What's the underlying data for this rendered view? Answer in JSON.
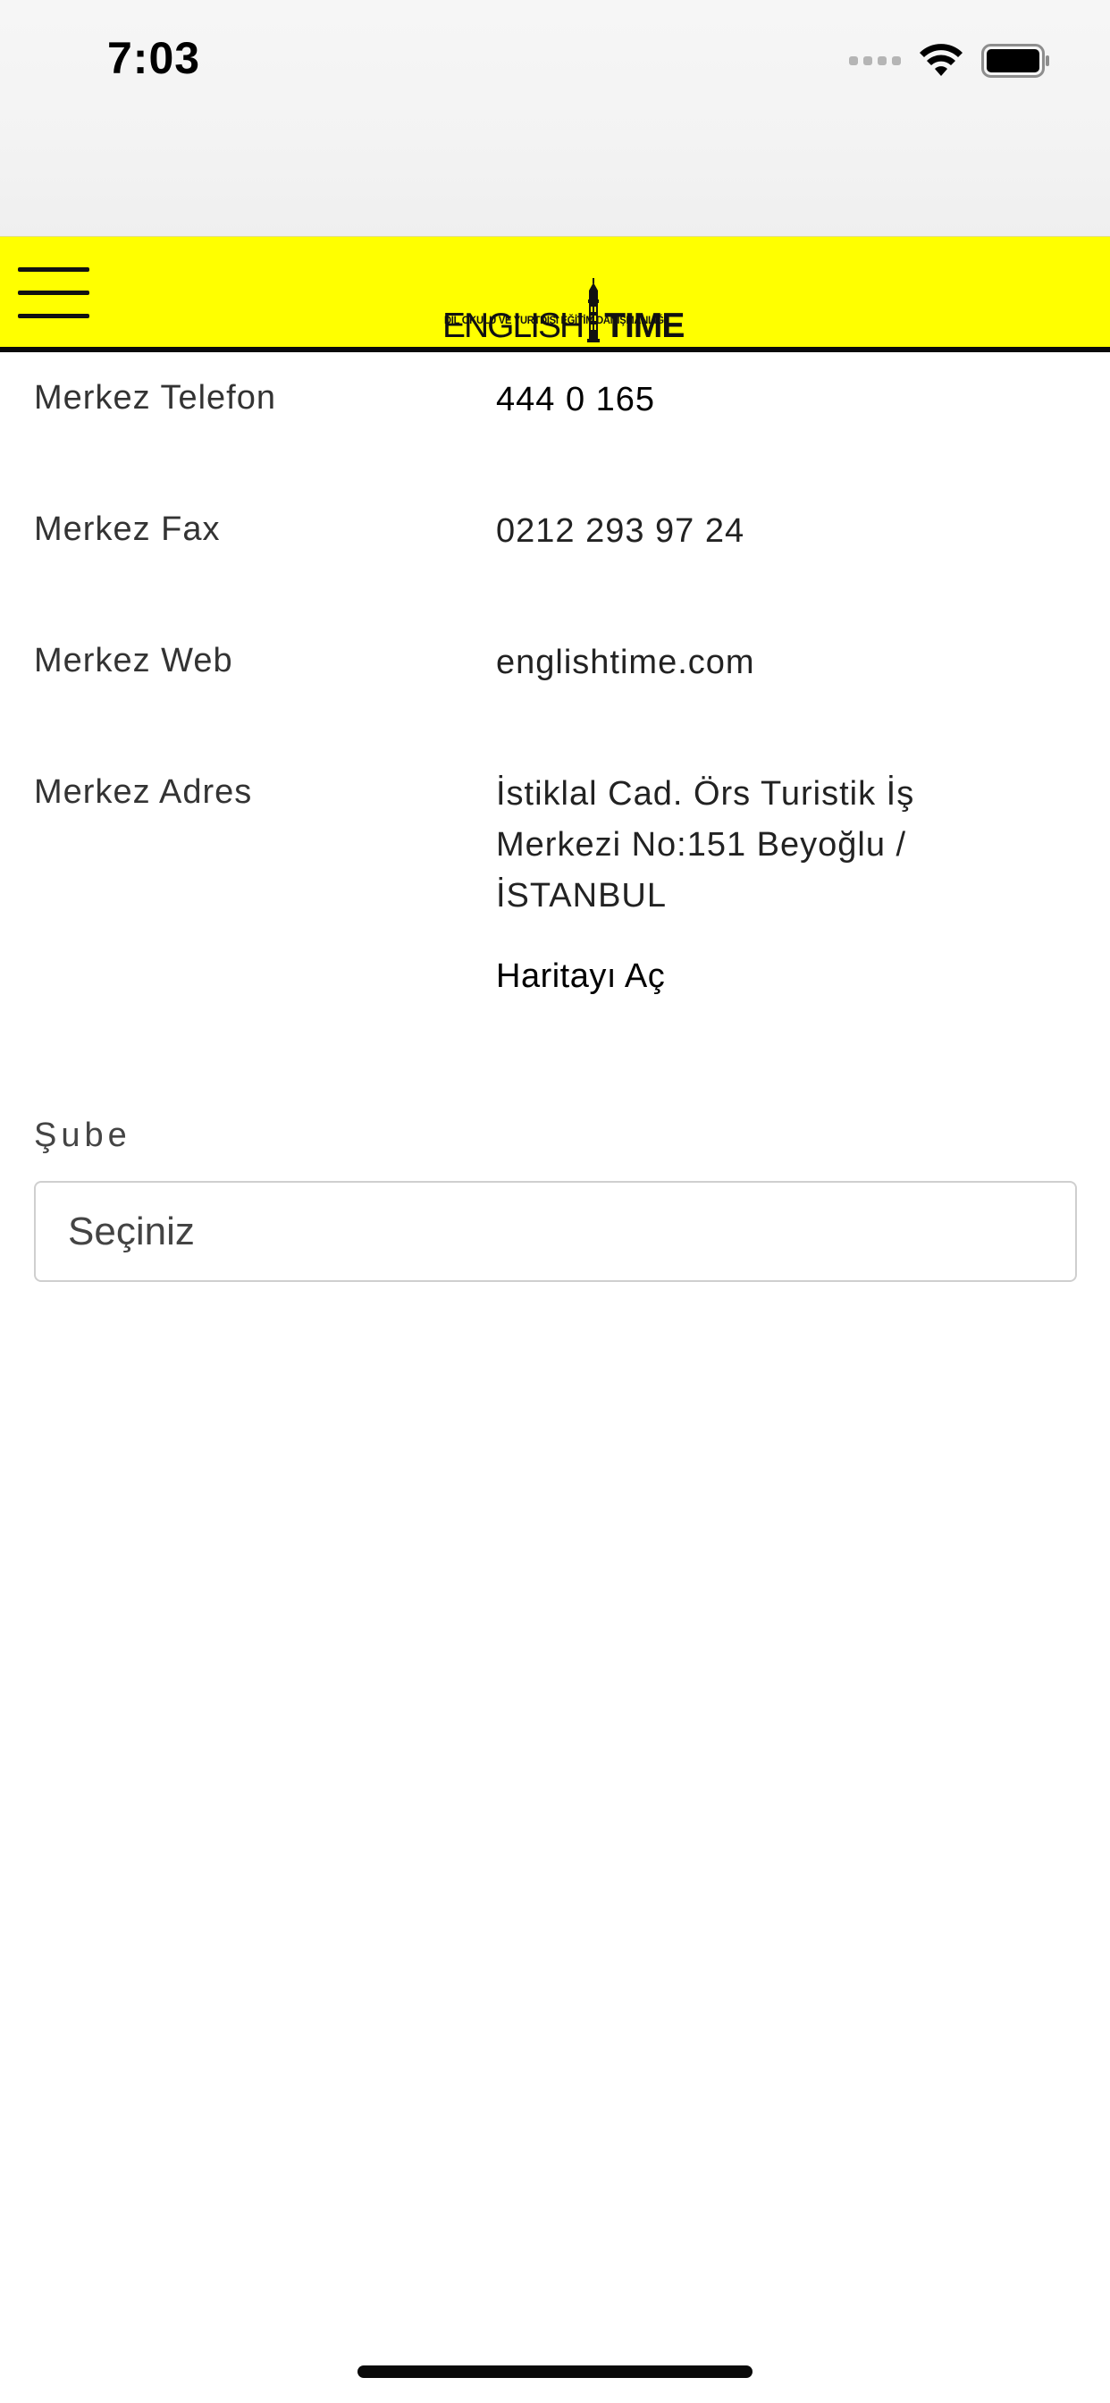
{
  "status_bar": {
    "time": "7:03"
  },
  "header": {
    "logo": {
      "word_left": "ENGLISH",
      "word_right": "TIME",
      "tagline": "DİL OKULU VE YURTDIŞI EĞİTİM DANIŞMANLIĞI"
    },
    "background_color": "#ffff00"
  },
  "contact": [
    {
      "label": "Merkez Telefon",
      "value": "444 0 165"
    },
    {
      "label": "Merkez Fax",
      "value": "0212 293 97 24"
    },
    {
      "label": "Merkez Web",
      "value": "englishtime.com"
    },
    {
      "label": "Merkez Adres",
      "value": "İstiklal Cad. Örs Turistik İş Merkezi No:151 Beyoğlu / İSTANBUL"
    }
  ],
  "map_link_label": "Haritayı Aç",
  "branch": {
    "label": "Şube",
    "selected": "Seçiniz"
  },
  "icons": {
    "menu": "hamburger-menu-icon",
    "wifi": "wifi-icon",
    "battery": "battery-icon",
    "signal": "signal-icon"
  }
}
